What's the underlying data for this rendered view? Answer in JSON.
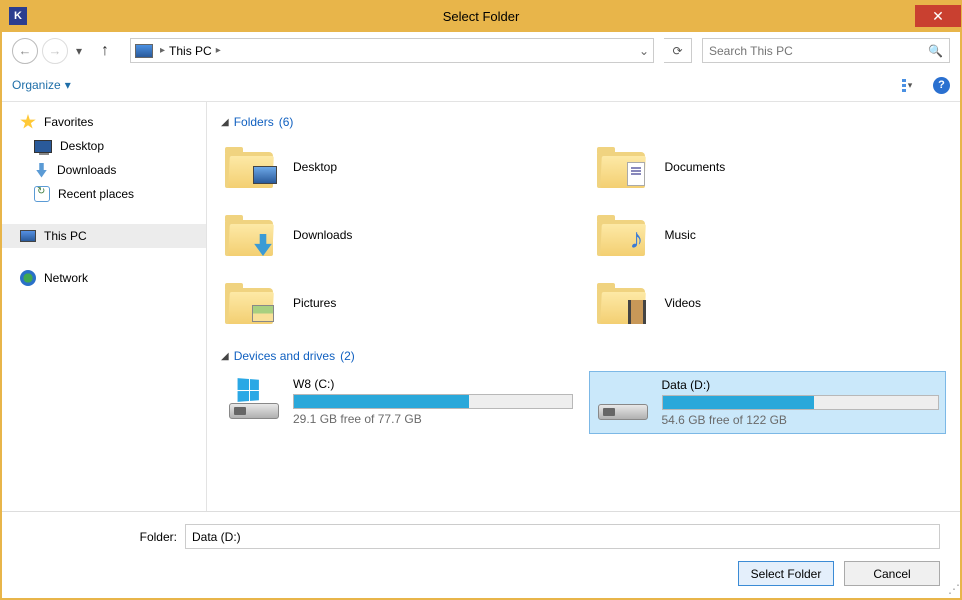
{
  "window": {
    "title": "Select Folder"
  },
  "breadcrumb": {
    "location": "This PC"
  },
  "search": {
    "placeholder": "Search This PC"
  },
  "toolbar": {
    "organize": "Organize"
  },
  "sidebar": {
    "favorites": "Favorites",
    "desktop": "Desktop",
    "downloads": "Downloads",
    "recent": "Recent places",
    "thispc": "This PC",
    "network": "Network"
  },
  "main": {
    "section1": {
      "label": "Folders",
      "count": "(6)"
    },
    "section2": {
      "label": "Devices and drives",
      "count": "(2)"
    },
    "folders": {
      "desktop": "Desktop",
      "documents": "Documents",
      "downloads": "Downloads",
      "music": "Music",
      "pictures": "Pictures",
      "videos": "Videos"
    },
    "drives": [
      {
        "name": "W8 (C:)",
        "free": "29.1 GB free of 77.7 GB",
        "pct": 63
      },
      {
        "name": "Data (D:)",
        "free": "54.6 GB free of 122 GB",
        "pct": 55
      }
    ]
  },
  "footer": {
    "label": "Folder:",
    "value": "Data (D:)",
    "select": "Select Folder",
    "cancel": "Cancel"
  }
}
